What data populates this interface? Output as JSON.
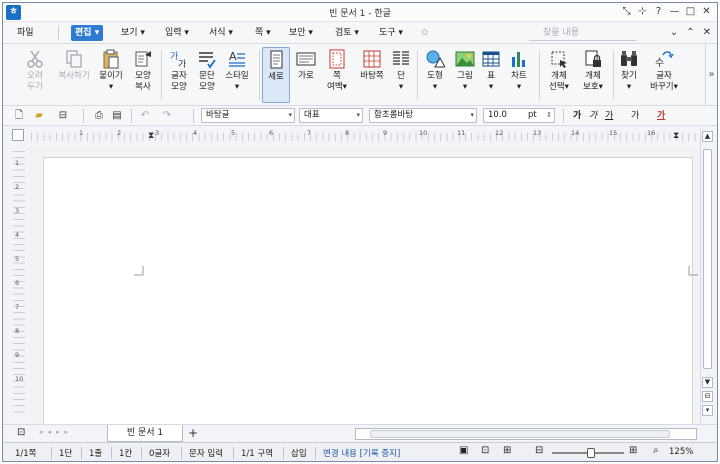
{
  "window": {
    "title": "빈 문서 1 - 한글",
    "app_icon": "ㅎ",
    "controls": [
      "⤡",
      "⊹",
      "?",
      "—",
      "□",
      "✕"
    ]
  },
  "menubar": {
    "items": [
      "파일",
      "편집",
      "보기",
      "입력",
      "서식",
      "쪽",
      "보안",
      "검토",
      "도구"
    ],
    "active": "편집",
    "search_placeholder": "찾을 내용",
    "right": [
      "⌄",
      "⌃",
      "✕"
    ]
  },
  "ribbon": {
    "buttons": [
      {
        "label1": "오려",
        "label2": "두기",
        "icon": "scissors-icon"
      },
      {
        "label1": "복사하기",
        "label2": "",
        "icon": "copy-icon"
      },
      {
        "label1": "붙이기",
        "label2": "▾",
        "icon": "paste-icon"
      },
      {
        "label1": "모양",
        "label2": "복사",
        "icon": "format-painter-icon"
      },
      {
        "label1": "글자",
        "label2": "모양",
        "icon": "char-shape-icon"
      },
      {
        "label1": "문단",
        "label2": "모양",
        "icon": "para-shape-icon"
      },
      {
        "label1": "스타일",
        "label2": "▾",
        "icon": "style-icon"
      },
      {
        "label1": "세로",
        "label2": "",
        "icon": "portrait-icon"
      },
      {
        "label1": "가로",
        "label2": "",
        "icon": "landscape-icon"
      },
      {
        "label1": "쪽",
        "label2": "여백▾",
        "icon": "page-margin-icon"
      },
      {
        "label1": "바탕쪽",
        "label2": "",
        "icon": "master-page-icon"
      },
      {
        "label1": "단",
        "label2": "▾",
        "icon": "columns-icon"
      },
      {
        "label1": "도형",
        "label2": "▾",
        "icon": "shape-icon"
      },
      {
        "label1": "그림",
        "label2": "▾",
        "icon": "picture-icon"
      },
      {
        "label1": "표",
        "label2": "▾",
        "icon": "table-icon"
      },
      {
        "label1": "차트",
        "label2": "▾",
        "icon": "chart-icon"
      },
      {
        "label1": "개체",
        "label2": "선택▾",
        "icon": "select-object-icon"
      },
      {
        "label1": "개체",
        "label2": "보호▾",
        "icon": "protect-object-icon"
      },
      {
        "label1": "찾기",
        "label2": "▾",
        "icon": "find-icon"
      },
      {
        "label1": "글자",
        "label2": "바꾸기▾",
        "icon": "replace-icon"
      }
    ],
    "more": "»"
  },
  "toolbar": {
    "style_combo": "바탕글",
    "lang_combo": "대표",
    "font_combo": "함초롬바탕",
    "size_value": "10.0",
    "size_unit": "pt",
    "fmt": [
      "가",
      "가",
      "가",
      "가",
      "가"
    ]
  },
  "ruler": {
    "h_numbers": [
      "1",
      "2",
      "3",
      "4",
      "5",
      "6",
      "7",
      "8",
      "9",
      "10",
      "11",
      "12",
      "13",
      "14",
      "15",
      "16"
    ],
    "v_numbers": [
      "1",
      "2",
      "3",
      "4",
      "5",
      "6",
      "7",
      "8",
      "9",
      "10"
    ]
  },
  "tabs": {
    "doc_tab": "빈 문서 1",
    "add": "+"
  },
  "statusbar": {
    "page": "1/1쪽",
    "col": "1단",
    "line": "1줄",
    "char": "1칸",
    "count": "0글자",
    "mode": "문자 입력",
    "section": "1/1 구역",
    "insert": "삽입",
    "track": "변경 내용 [기록 중지]",
    "zoom": "125%"
  }
}
